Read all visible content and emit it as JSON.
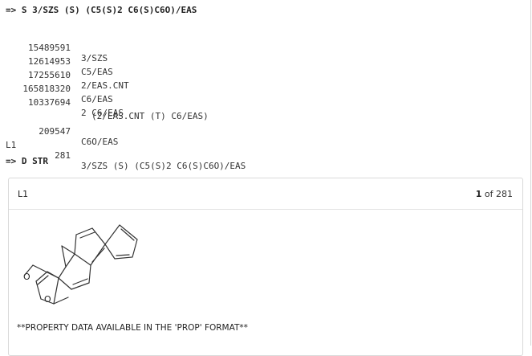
{
  "search_command": "=> S 3/SZS (S) (C5(S)2 C6(S)C6O)/EAS",
  "results": [
    {
      "label": "",
      "count": "15489591",
      "query": "3/SZS"
    },
    {
      "label": "",
      "count": "12614953",
      "query": "C5/EAS"
    },
    {
      "label": "",
      "count": "17255610",
      "query": "2/EAS.CNT"
    },
    {
      "label": "",
      "count": "165818320",
      "query": "C6/EAS"
    },
    {
      "label": "",
      "count": "10337694",
      "query": "2 C6/EAS"
    },
    {
      "label": "",
      "count": "",
      "query": "(2/EAS.CNT (T) C6/EAS)"
    },
    {
      "label": "",
      "count": "209547",
      "query": "C6O/EAS"
    },
    {
      "label": "L1",
      "count": "281",
      "query": "3/SZS (S) (C5(S)2 C6(S)C6O)/EAS"
    }
  ],
  "display_command": "=> D STR",
  "card": {
    "title": "L1",
    "current": "1",
    "of_text": "of 281",
    "property_note": "**PROPERTY DATA AVAILABLE IN THE 'PROP' FORMAT**"
  }
}
